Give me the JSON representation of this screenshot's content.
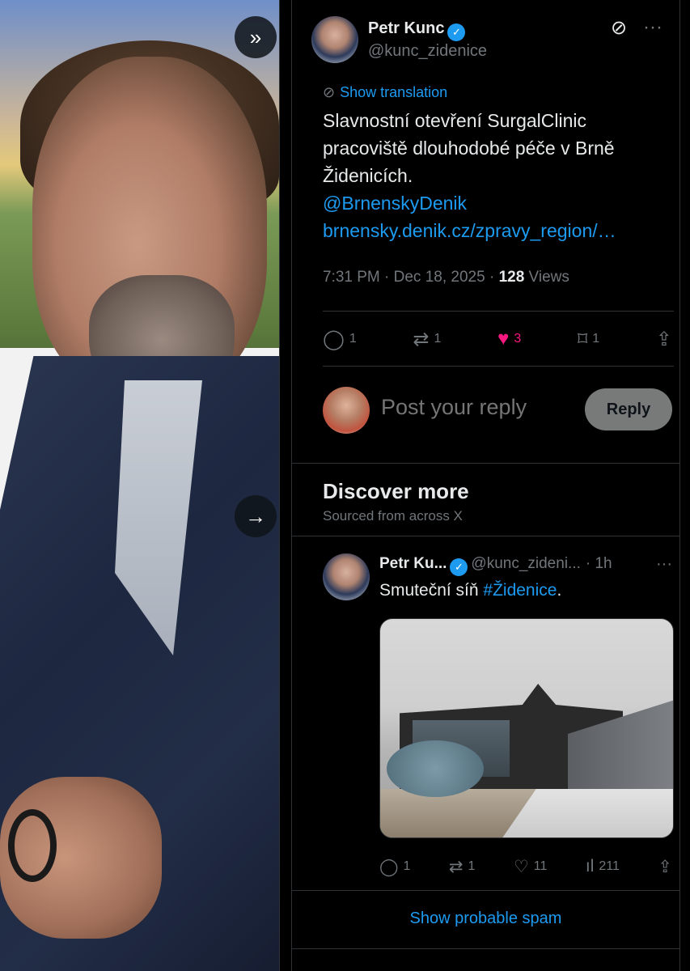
{
  "nav": {
    "next_icon": "»",
    "forward_icon": "→"
  },
  "post": {
    "display_name": "Petr Kunc",
    "handle": "@kunc_zidenice",
    "translation_label": "Show translation",
    "text_line1": "Slavnostní otevření SurgalClinic",
    "text_line2": "pracoviště dlouhodobé péče v Brně",
    "text_line3": "Židenicích.",
    "mention": "@BrnenskyDenik",
    "link": "brnensky.denik.cz/zpravy_region/…",
    "time": "7:31 PM · Dec 18, 2025 · ",
    "views_count": "128",
    "views_label": " Views",
    "replies": "1",
    "reposts": "1",
    "likes": "3",
    "bookmarks": "1"
  },
  "reply": {
    "placeholder": "Post your reply",
    "button": "Reply"
  },
  "discover": {
    "title": "Discover more",
    "subtitle": "Sourced from across X",
    "post": {
      "display_name": "Petr Ku...",
      "handle": "@kunc_zideni...",
      "time": "· 1h",
      "text": "Smuteční síň ",
      "hashtag": "#Židenice",
      "text_end": ".",
      "replies": "1",
      "reposts": "1",
      "likes": "11",
      "views": "211"
    }
  },
  "spam_label": "Show probable spam",
  "colors": {
    "accent": "#1d9bf0",
    "like": "#f91880",
    "background": "#000000"
  }
}
